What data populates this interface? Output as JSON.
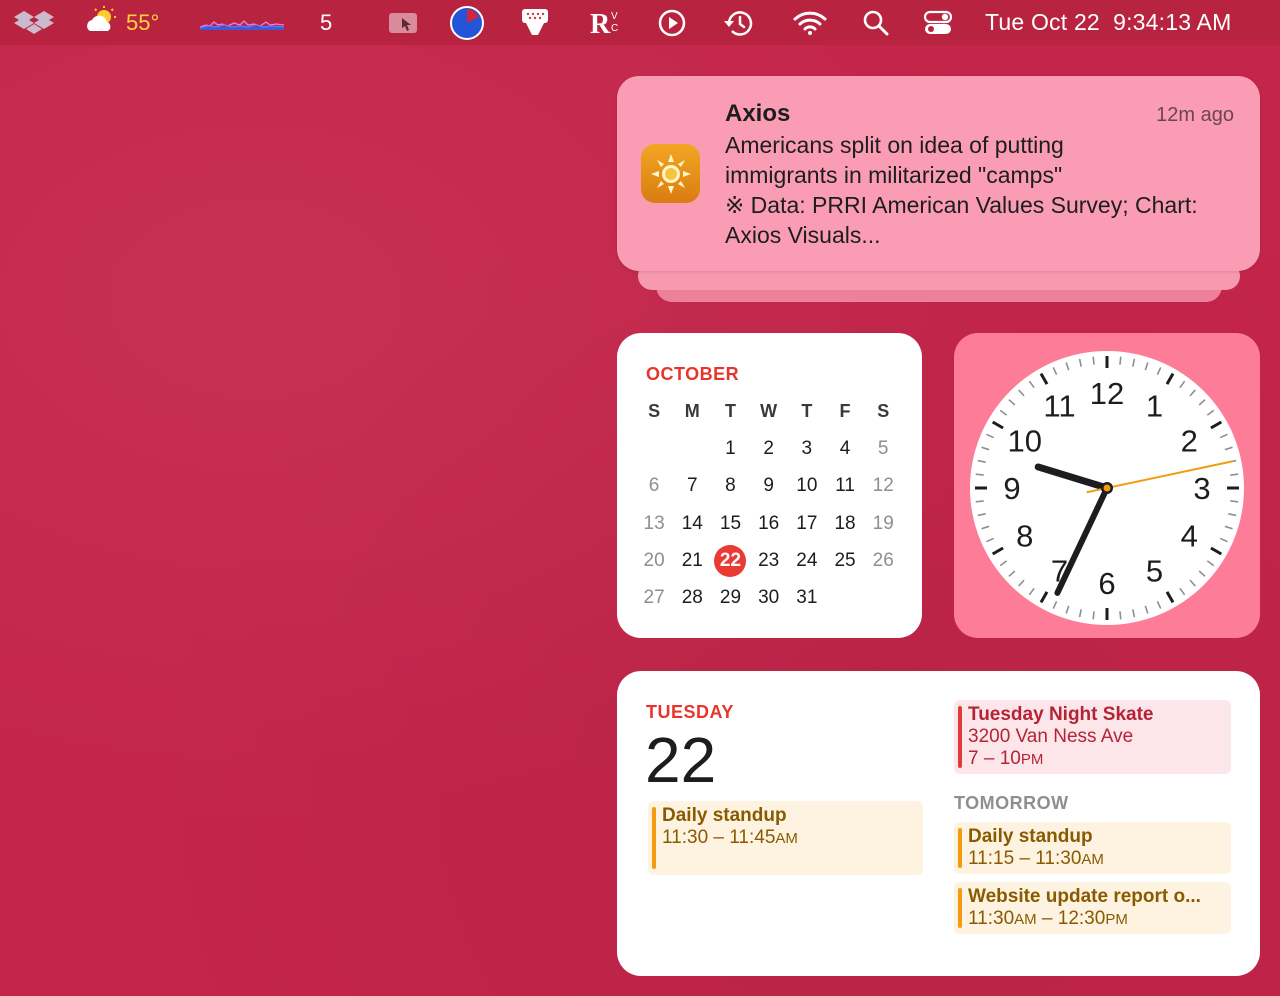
{
  "menubar": {
    "weather_temp": "55°",
    "badge_count": "5",
    "datetime": "Tue Oct 22  9:34:13 AM",
    "icons": [
      "dropbox-icon",
      "weather-icon",
      "activity-graph-icon",
      "cursor-pro-icon",
      "timer-icon",
      "shower-icon",
      "rv-icon",
      "play-icon",
      "time-machine-icon",
      "wifi-icon",
      "search-icon",
      "control-center-icon"
    ]
  },
  "notification": {
    "app": "Axios",
    "time": "12m ago",
    "line1": "Americans split on idea of putting",
    "line2": "immigrants in militarized \"camps\"",
    "line3": "※ Data: PRRI American Values Survey; Chart:",
    "line4": "Axios Visuals..."
  },
  "calendar": {
    "month": "OCTOBER",
    "weekdays": [
      "S",
      "M",
      "T",
      "W",
      "T",
      "F",
      "S"
    ],
    "weeks": [
      [
        "",
        "",
        "1",
        "2",
        "3",
        "4",
        "5"
      ],
      [
        "6",
        "7",
        "8",
        "9",
        "10",
        "11",
        "12"
      ],
      [
        "13",
        "14",
        "15",
        "16",
        "17",
        "18",
        "19"
      ],
      [
        "20",
        "21",
        "22",
        "23",
        "24",
        "25",
        "26"
      ],
      [
        "27",
        "28",
        "29",
        "30",
        "31",
        "",
        ""
      ]
    ],
    "today": "22"
  },
  "clock": {
    "numbers": [
      "12",
      "1",
      "2",
      "3",
      "4",
      "5",
      "6",
      "7",
      "8",
      "9",
      "10",
      "11"
    ],
    "hour": 9,
    "minute": 34,
    "second": 13
  },
  "upnext": {
    "day_label": "TUESDAY",
    "date": "22",
    "today_event": {
      "title": "Daily standup",
      "time": "11:30 – 11:45",
      "suffix": "AM"
    },
    "right_event": {
      "title": "Tuesday Night Skate",
      "location": "3200 Van Ness Ave",
      "time": "7 – 10",
      "suffix": "PM"
    },
    "tomorrow_label": "TOMORROW",
    "tomorrow_events": [
      {
        "title": "Daily standup",
        "time_a": "11:15 – 11:30",
        "suffix_a": "AM",
        "time_b": "",
        "suffix_b": ""
      },
      {
        "title": "Website update report o...",
        "time_a": "11:30",
        "suffix_a": "AM",
        "time_b": " – 12:30",
        "suffix_b": "PM"
      }
    ]
  },
  "colors": {
    "wallpaper": "#c4254a",
    "menubar": "#b8233f",
    "notification": "#fa9db4",
    "clock_widget": "#fd7c98",
    "accent_red": "#e8352c",
    "second_hand": "#f39c12"
  }
}
